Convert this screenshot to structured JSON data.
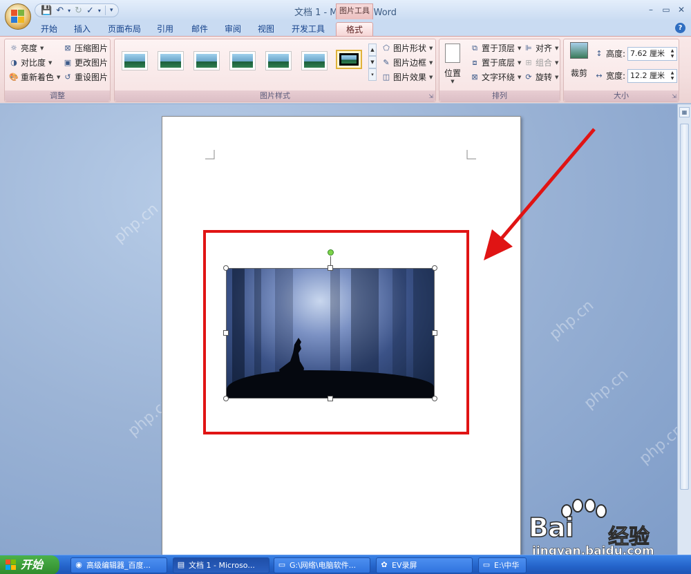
{
  "window": {
    "title": "文档 1 - Microsoft Word",
    "context_tab_group": "图片工具",
    "controls": {
      "minimize": "–",
      "restore": "▭",
      "close": "✕"
    }
  },
  "tabs": [
    {
      "label": "开始"
    },
    {
      "label": "插入"
    },
    {
      "label": "页面布局"
    },
    {
      "label": "引用"
    },
    {
      "label": "邮件"
    },
    {
      "label": "审阅"
    },
    {
      "label": "视图"
    },
    {
      "label": "开发工具"
    },
    {
      "label": "格式",
      "active": true
    }
  ],
  "ribbon": {
    "adjust": {
      "label": "调整",
      "brightness": "亮度",
      "contrast": "对比度",
      "recolor": "重新着色",
      "compress": "压缩图片",
      "change_picture": "更改图片",
      "reset_picture": "重设图片"
    },
    "styles": {
      "label": "图片样式",
      "shape": "图片形状",
      "border": "图片边框",
      "effects": "图片效果"
    },
    "arrange": {
      "label": "排列",
      "position": "位置",
      "bring_front": "置于顶层",
      "send_back": "置于底层",
      "wrap_text": "文字环绕",
      "align": "对齐",
      "group": "组合",
      "rotate": "旋转"
    },
    "size": {
      "label": "大小",
      "crop": "裁剪",
      "height_label": "高度:",
      "height_value": "7.62 厘米",
      "width_label": "宽度:",
      "width_value": "12.2 厘米"
    }
  },
  "watermark_text": "php.cn",
  "taskbar": {
    "start": "开始",
    "tasks": [
      {
        "label": "高级编辑器_百度..."
      },
      {
        "label": "文档 1 - Microso..."
      },
      {
        "label": "G:\\网络\\电脑软件..."
      },
      {
        "label": "EV录屏"
      },
      {
        "label": "E:\\中华"
      }
    ]
  },
  "brand": {
    "name": "Bai",
    "name_suffix": "经验",
    "url": "jingyan.baidu.com"
  },
  "colors": {
    "highlight": "#e01414",
    "context_tab": "#f6d6d6",
    "rotate_handle": "#7dd34a"
  }
}
